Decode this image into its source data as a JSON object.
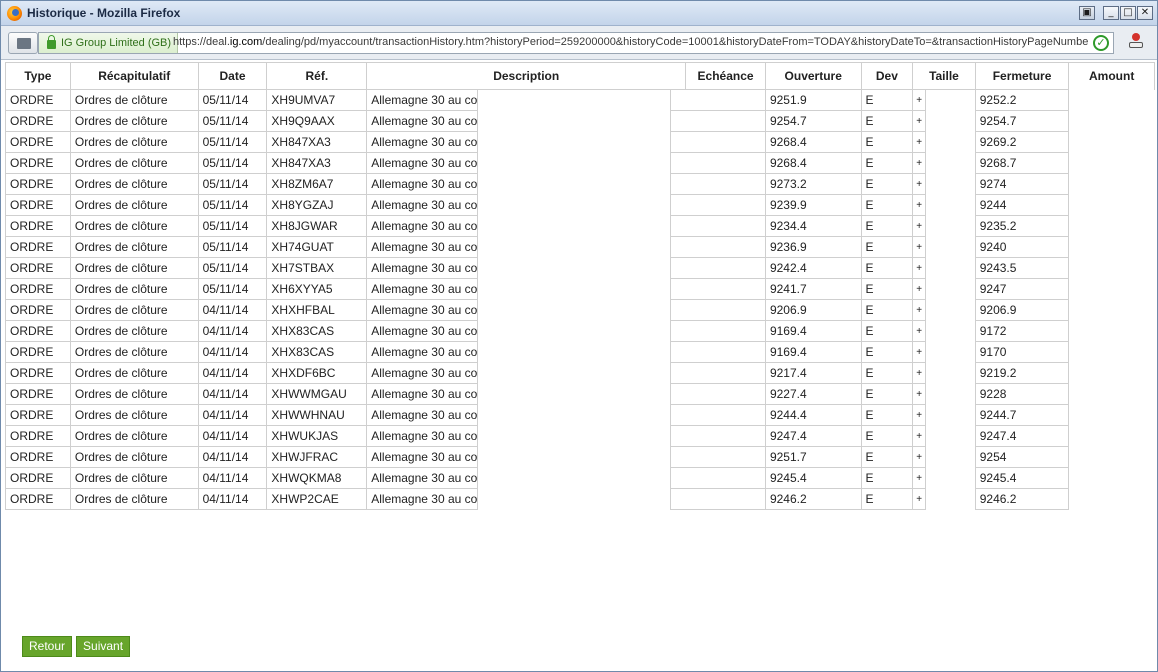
{
  "window": {
    "title": "Historique - Mozilla Firefox"
  },
  "urlbar": {
    "identity": "IG Group Limited (GB)",
    "url_prefix": "https://deal.",
    "url_domain": "ig.com",
    "url_rest": "/dealing/pd/myaccount/transactionHistory.htm?historyPeriod=259200000&historyCode=10001&historyDateFrom=TODAY&historyDateTo=&transactionHistoryPageNumbe"
  },
  "table": {
    "headers": [
      "Type",
      "Récapitulatif",
      "Date",
      "Réf.",
      "Description",
      "Echéance",
      "Ouverture",
      "Dev",
      "Taille",
      "Fermeture",
      "Amount"
    ],
    "rows": [
      {
        "type": "ORDRE",
        "recap": "Ordres de clôture",
        "date": "05/11/14",
        "ref": "XH9UMVA7",
        "desc": "Allemagne 30 au co",
        "ouv": "9251.9",
        "dev": "E",
        "taille": "+",
        "ferm": "9252.2"
      },
      {
        "type": "ORDRE",
        "recap": "Ordres de clôture",
        "date": "05/11/14",
        "ref": "XH9Q9AAX",
        "desc": "Allemagne 30 au co",
        "ouv": "9254.7",
        "dev": "E",
        "taille": "+",
        "ferm": "9254.7"
      },
      {
        "type": "ORDRE",
        "recap": "Ordres de clôture",
        "date": "05/11/14",
        "ref": "XH847XA3",
        "desc": "Allemagne 30 au co",
        "ouv": "9268.4",
        "dev": "E",
        "taille": "+",
        "ferm": "9269.2"
      },
      {
        "type": "ORDRE",
        "recap": "Ordres de clôture",
        "date": "05/11/14",
        "ref": "XH847XA3",
        "desc": "Allemagne 30 au co",
        "ouv": "9268.4",
        "dev": "E",
        "taille": "+",
        "ferm": "9268.7"
      },
      {
        "type": "ORDRE",
        "recap": "Ordres de clôture",
        "date": "05/11/14",
        "ref": "XH8ZM6A7",
        "desc": "Allemagne 30 au co",
        "ouv": "9273.2",
        "dev": "E",
        "taille": "+",
        "ferm": "9274"
      },
      {
        "type": "ORDRE",
        "recap": "Ordres de clôture",
        "date": "05/11/14",
        "ref": "XH8YGZAJ",
        "desc": "Allemagne 30 au co",
        "ouv": "9239.9",
        "dev": "E",
        "taille": "+",
        "ferm": "9244"
      },
      {
        "type": "ORDRE",
        "recap": "Ordres de clôture",
        "date": "05/11/14",
        "ref": "XH8JGWAR",
        "desc": "Allemagne 30 au co",
        "ouv": "9234.4",
        "dev": "E",
        "taille": "+",
        "ferm": "9235.2"
      },
      {
        "type": "ORDRE",
        "recap": "Ordres de clôture",
        "date": "05/11/14",
        "ref": "XH74GUAT",
        "desc": "Allemagne 30 au co",
        "ouv": "9236.9",
        "dev": "E",
        "taille": "+",
        "ferm": "9240"
      },
      {
        "type": "ORDRE",
        "recap": "Ordres de clôture",
        "date": "05/11/14",
        "ref": "XH7STBAX",
        "desc": "Allemagne 30 au co",
        "ouv": "9242.4",
        "dev": "E",
        "taille": "+",
        "ferm": "9243.5"
      },
      {
        "type": "ORDRE",
        "recap": "Ordres de clôture",
        "date": "05/11/14",
        "ref": "XH6XYYA5",
        "desc": "Allemagne 30 au co",
        "ouv": "9241.7",
        "dev": "E",
        "taille": "+",
        "ferm": "9247"
      },
      {
        "type": "ORDRE",
        "recap": "Ordres de clôture",
        "date": "04/11/14",
        "ref": "XHXHFBAL",
        "desc": "Allemagne 30 au co",
        "ouv": "9206.9",
        "dev": "E",
        "taille": "+",
        "ferm": "9206.9"
      },
      {
        "type": "ORDRE",
        "recap": "Ordres de clôture",
        "date": "04/11/14",
        "ref": "XHX83CAS",
        "desc": "Allemagne 30 au co",
        "ouv": "9169.4",
        "dev": "E",
        "taille": "+",
        "ferm": "9172"
      },
      {
        "type": "ORDRE",
        "recap": "Ordres de clôture",
        "date": "04/11/14",
        "ref": "XHX83CAS",
        "desc": "Allemagne 30 au co",
        "ouv": "9169.4",
        "dev": "E",
        "taille": "+",
        "ferm": "9170"
      },
      {
        "type": "ORDRE",
        "recap": "Ordres de clôture",
        "date": "04/11/14",
        "ref": "XHXDF6BC",
        "desc": "Allemagne 30 au co",
        "ouv": "9217.4",
        "dev": "E",
        "taille": "+",
        "ferm": "9219.2"
      },
      {
        "type": "ORDRE",
        "recap": "Ordres de clôture",
        "date": "04/11/14",
        "ref": "XHWWMGAU",
        "desc": "Allemagne 30 au co",
        "ouv": "9227.4",
        "dev": "E",
        "taille": "+",
        "ferm": "9228"
      },
      {
        "type": "ORDRE",
        "recap": "Ordres de clôture",
        "date": "04/11/14",
        "ref": "XHWWHNAU",
        "desc": "Allemagne 30 au co",
        "ouv": "9244.4",
        "dev": "E",
        "taille": "+",
        "ferm": "9244.7"
      },
      {
        "type": "ORDRE",
        "recap": "Ordres de clôture",
        "date": "04/11/14",
        "ref": "XHWUKJAS",
        "desc": "Allemagne 30 au co",
        "ouv": "9247.4",
        "dev": "E",
        "taille": "+",
        "ferm": "9247.4"
      },
      {
        "type": "ORDRE",
        "recap": "Ordres de clôture",
        "date": "04/11/14",
        "ref": "XHWJFRAC",
        "desc": "Allemagne 30 au co",
        "ouv": "9251.7",
        "dev": "E",
        "taille": "+",
        "ferm": "9254"
      },
      {
        "type": "ORDRE",
        "recap": "Ordres de clôture",
        "date": "04/11/14",
        "ref": "XHWQKMA8",
        "desc": "Allemagne 30 au co",
        "ouv": "9245.4",
        "dev": "E",
        "taille": "+",
        "ferm": "9245.4"
      },
      {
        "type": "ORDRE",
        "recap": "Ordres de clôture",
        "date": "04/11/14",
        "ref": "XHWP2CAE",
        "desc": "Allemagne 30 au co",
        "ouv": "9246.2",
        "dev": "E",
        "taille": "+",
        "ferm": "9246.2"
      }
    ]
  },
  "buttons": {
    "prev": "Retour",
    "next": "Suivant"
  },
  "icons": {
    "app": "firefox-icon",
    "lock": "lock-icon",
    "secure": "check-icon"
  },
  "colors": {
    "button_green": "#67a52b",
    "identity_green": "#2e6f18"
  }
}
